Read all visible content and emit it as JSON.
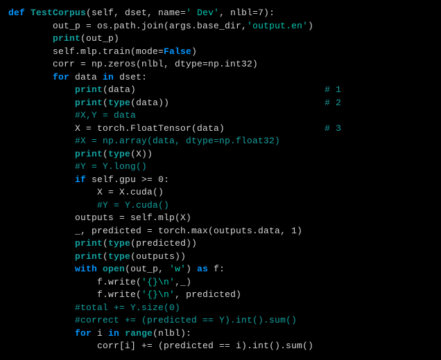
{
  "code": {
    "lines": [
      {
        "indent": 0,
        "segments": [
          {
            "cls": "kw",
            "t": "def "
          },
          {
            "cls": "fn",
            "t": "TestCorpus"
          },
          {
            "cls": "punct",
            "t": "(self, dset, name="
          },
          {
            "cls": "str",
            "t": "' Dev'"
          },
          {
            "cls": "punct",
            "t": ", nlbl="
          },
          {
            "cls": "num",
            "t": "7"
          },
          {
            "cls": "punct",
            "t": "):"
          }
        ]
      },
      {
        "indent": 2,
        "segments": [
          {
            "cls": "punct",
            "t": "out_p = os.path.join(args.base_dir,"
          },
          {
            "cls": "str",
            "t": "'output.en'"
          },
          {
            "cls": "punct",
            "t": ")"
          }
        ]
      },
      {
        "indent": 2,
        "segments": [
          {
            "cls": "builtin",
            "t": "print"
          },
          {
            "cls": "punct",
            "t": "(out_p)"
          }
        ]
      },
      {
        "indent": 2,
        "segments": [
          {
            "cls": "punct",
            "t": "self.mlp.train(mode="
          },
          {
            "cls": "const",
            "t": "False"
          },
          {
            "cls": "punct",
            "t": ")"
          }
        ]
      },
      {
        "indent": 2,
        "segments": [
          {
            "cls": "punct",
            "t": "corr = np.zeros(nlbl, dtype=np.int32)"
          }
        ]
      },
      {
        "indent": 2,
        "segments": [
          {
            "cls": "kw",
            "t": "for"
          },
          {
            "cls": "punct",
            "t": " data "
          },
          {
            "cls": "kw",
            "t": "in"
          },
          {
            "cls": "punct",
            "t": " dset:"
          }
        ]
      },
      {
        "indent": 3,
        "segments": [
          {
            "cls": "builtin",
            "t": "print"
          },
          {
            "cls": "punct",
            "t": "(data)"
          }
        ],
        "trail": {
          "col": 57,
          "cls": "comment",
          "t": "# 1"
        }
      },
      {
        "indent": 3,
        "segments": [
          {
            "cls": "builtin",
            "t": "print"
          },
          {
            "cls": "punct",
            "t": "("
          },
          {
            "cls": "builtin",
            "t": "type"
          },
          {
            "cls": "punct",
            "t": "(data))"
          }
        ],
        "trail": {
          "col": 57,
          "cls": "comment",
          "t": "# 2"
        }
      },
      {
        "indent": 3,
        "segments": [
          {
            "cls": "comment",
            "t": "#X,Y = data"
          }
        ]
      },
      {
        "indent": 3,
        "segments": [
          {
            "cls": "punct",
            "t": "X = torch.FloatTensor(data)"
          }
        ],
        "trail": {
          "col": 57,
          "cls": "comment",
          "t": "# 3"
        }
      },
      {
        "indent": 3,
        "segments": [
          {
            "cls": "comment",
            "t": "#X = np.array(data, dtype=np.float32)"
          }
        ]
      },
      {
        "indent": 3,
        "segments": [
          {
            "cls": "builtin",
            "t": "print"
          },
          {
            "cls": "punct",
            "t": "("
          },
          {
            "cls": "builtin",
            "t": "type"
          },
          {
            "cls": "punct",
            "t": "(X))"
          }
        ]
      },
      {
        "indent": 3,
        "segments": [
          {
            "cls": "comment",
            "t": "#Y = Y.long()"
          }
        ]
      },
      {
        "indent": 3,
        "segments": [
          {
            "cls": "kw",
            "t": "if"
          },
          {
            "cls": "punct",
            "t": " self.gpu >= "
          },
          {
            "cls": "num",
            "t": "0"
          },
          {
            "cls": "punct",
            "t": ":"
          }
        ]
      },
      {
        "indent": 4,
        "segments": [
          {
            "cls": "punct",
            "t": "X = X.cuda()"
          }
        ]
      },
      {
        "indent": 4,
        "segments": [
          {
            "cls": "comment",
            "t": "#Y = Y.cuda()"
          }
        ]
      },
      {
        "indent": 3,
        "segments": [
          {
            "cls": "punct",
            "t": "outputs = self.mlp(X)"
          }
        ]
      },
      {
        "indent": 3,
        "segments": [
          {
            "cls": "punct",
            "t": "_, predicted = torch.max(outputs.data, "
          },
          {
            "cls": "num",
            "t": "1"
          },
          {
            "cls": "punct",
            "t": ")"
          }
        ]
      },
      {
        "indent": 3,
        "segments": [
          {
            "cls": "builtin",
            "t": "print"
          },
          {
            "cls": "punct",
            "t": "("
          },
          {
            "cls": "builtin",
            "t": "type"
          },
          {
            "cls": "punct",
            "t": "(predicted))"
          }
        ]
      },
      {
        "indent": 3,
        "segments": [
          {
            "cls": "builtin",
            "t": "print"
          },
          {
            "cls": "punct",
            "t": "("
          },
          {
            "cls": "builtin",
            "t": "type"
          },
          {
            "cls": "punct",
            "t": "(outputs))"
          }
        ]
      },
      {
        "indent": 3,
        "segments": [
          {
            "cls": "kw",
            "t": "with"
          },
          {
            "cls": "punct",
            "t": " "
          },
          {
            "cls": "builtin",
            "t": "open"
          },
          {
            "cls": "punct",
            "t": "(out_p, "
          },
          {
            "cls": "str",
            "t": "'w'"
          },
          {
            "cls": "punct",
            "t": ") "
          },
          {
            "cls": "kw",
            "t": "as"
          },
          {
            "cls": "punct",
            "t": " f:"
          }
        ]
      },
      {
        "indent": 4,
        "segments": [
          {
            "cls": "punct",
            "t": "f.write("
          },
          {
            "cls": "str",
            "t": "'{}\\n'"
          },
          {
            "cls": "punct",
            "t": ",_)"
          }
        ]
      },
      {
        "indent": 4,
        "segments": [
          {
            "cls": "punct",
            "t": "f.write("
          },
          {
            "cls": "str",
            "t": "'{}\\n'"
          },
          {
            "cls": "punct",
            "t": ", predicted)"
          }
        ]
      },
      {
        "indent": 3,
        "segments": [
          {
            "cls": "comment",
            "t": "#total += Y.size(0)"
          }
        ]
      },
      {
        "indent": 3,
        "segments": [
          {
            "cls": "comment",
            "t": "#correct += (predicted == Y).int().sum()"
          }
        ]
      },
      {
        "indent": 3,
        "segments": [
          {
            "cls": "kw",
            "t": "for"
          },
          {
            "cls": "punct",
            "t": " i "
          },
          {
            "cls": "kw",
            "t": "in"
          },
          {
            "cls": "punct",
            "t": " "
          },
          {
            "cls": "builtin",
            "t": "range"
          },
          {
            "cls": "punct",
            "t": "(nlbl):"
          }
        ]
      },
      {
        "indent": 4,
        "segments": [
          {
            "cls": "punct",
            "t": "corr[i] += (predicted == i).int().sum()"
          }
        ]
      }
    ]
  }
}
